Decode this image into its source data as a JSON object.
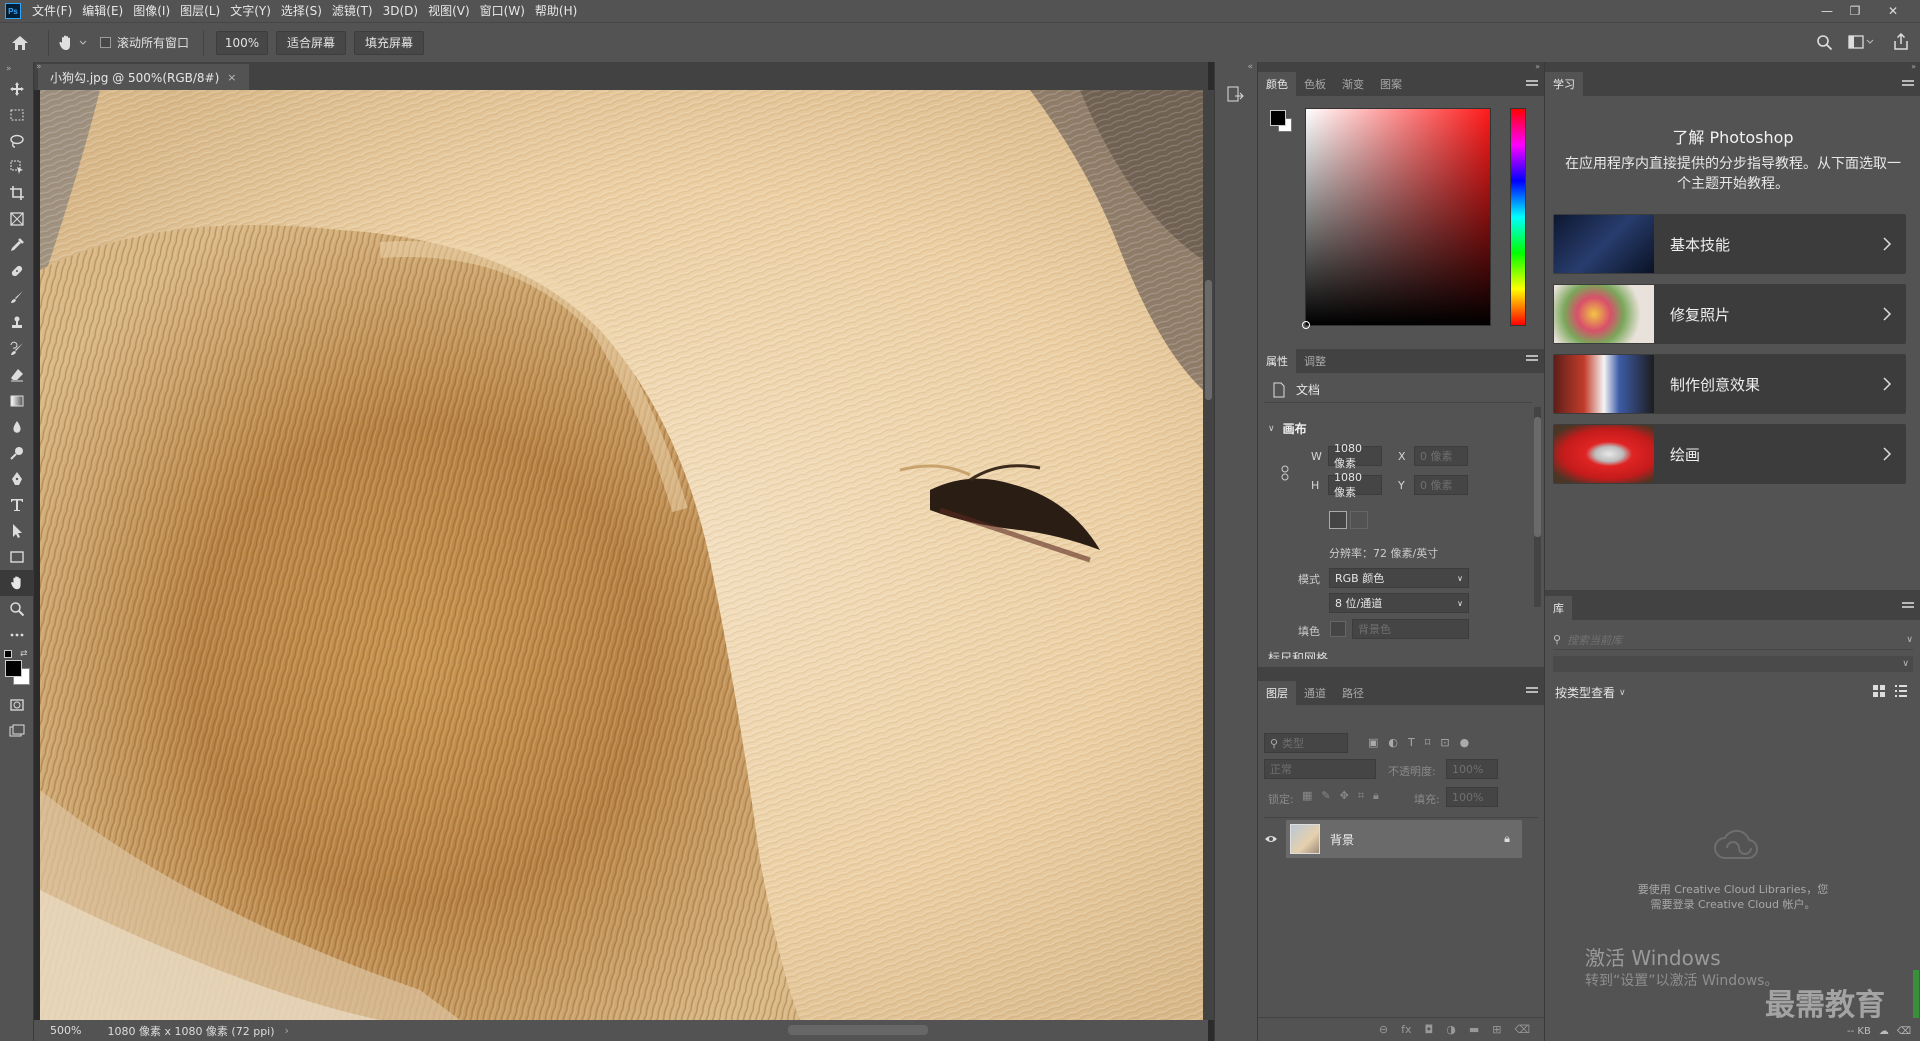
{
  "app": {
    "logo": "Ps"
  },
  "menu": [
    "文件(F)",
    "编辑(E)",
    "图像(I)",
    "图层(L)",
    "文字(Y)",
    "选择(S)",
    "滤镜(T)",
    "3D(D)",
    "视图(V)",
    "窗口(W)",
    "帮助(H)"
  ],
  "options_bar": {
    "scroll_all_label": "滚动所有窗口",
    "zoom_value": "100%",
    "fit_screen": "适合屏幕",
    "fill_screen": "填充屏幕"
  },
  "document": {
    "tab_title": "小狗勾.jpg @ 500%(RGB/8#)",
    "status_zoom": "500%",
    "status_info": "1080 像素 x 1080 像素 (72 ppi)"
  },
  "color_panel": {
    "tabs": [
      "颜色",
      "色板",
      "渐变",
      "图案"
    ],
    "foreground": "#000000",
    "background": "#ffffff",
    "hue_color": "#ff1a1a"
  },
  "properties_panel": {
    "tabs": [
      "属性",
      "调整"
    ],
    "doc_label": "文档",
    "canvas_section": "画布",
    "w_label": "W",
    "w_value": "1080 像素",
    "h_label": "H",
    "h_value": "1080 像素",
    "x_label": "X",
    "x_placeholder": "0 像素",
    "y_label": "Y",
    "y_placeholder": "0 像素",
    "resolution": "分辨率：72 像素/英寸",
    "mode_label": "模式",
    "mode_value": "RGB 颜色",
    "depth_value": "8 位/通道",
    "fill_label": "填色",
    "fill_value": "背景色",
    "next_section": "标尺和网格"
  },
  "layers_panel": {
    "tabs": [
      "图层",
      "通道",
      "路径"
    ],
    "filter_placeholder": "类型",
    "blend_mode": "正常",
    "opacity_label": "不透明度:",
    "opacity_value": "100%",
    "lock_label": "锁定:",
    "fill_label": "填充:",
    "fill_value": "100%",
    "layers": [
      {
        "name": "背景"
      }
    ]
  },
  "learn_panel": {
    "tab": "学习",
    "heading": "了解 Photoshop",
    "description": "在应用程序内直接提供的分步指导教程。从下面选取一个主题开始教程。",
    "cards": [
      {
        "label": "基本技能"
      },
      {
        "label": "修复照片"
      },
      {
        "label": "制作创意效果"
      },
      {
        "label": "绘画"
      }
    ]
  },
  "library_panel": {
    "tab": "库",
    "search_placeholder": "搜索当前库",
    "view_by": "按类型查看",
    "signin_message_line1": "要使用 Creative Cloud Libraries，您",
    "signin_message_line2": "需要登录 Creative Cloud 帐户。",
    "size": "-- KB"
  },
  "watermark": {
    "activate_title": "激活 Windows",
    "activate_sub": "转到“设置”以激活 Windows。",
    "brand": "最需教育"
  }
}
